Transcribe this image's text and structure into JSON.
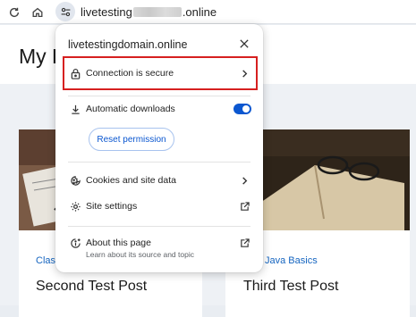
{
  "browser": {
    "address_prefix": "livetesting",
    "address_suffix": ".online"
  },
  "page": {
    "title": "My B",
    "cards": [
      {
        "category": "Clas",
        "title": "Second Test Post"
      },
      {
        "category": "Java Basics",
        "title": "Third Test Post"
      }
    ]
  },
  "popup": {
    "domain": "livetestingdomain.online",
    "connection_label": "Connection is secure",
    "auto_downloads_label": "Automatic downloads",
    "auto_downloads_enabled": true,
    "reset_button": "Reset permission",
    "cookies_label": "Cookies and site data",
    "site_settings_label": "Site settings",
    "about_label": "About this page",
    "about_sub": "Learn about its source and topic"
  },
  "colors": {
    "accent": "#0b57d0",
    "highlight_border": "#d62020",
    "link": "#1565c0"
  },
  "icons": [
    "reload-icon",
    "home-icon",
    "tune-icon",
    "close-icon",
    "lock-icon",
    "chevron-right-icon",
    "download-icon",
    "cookie-icon",
    "gear-icon",
    "open-in-new-icon",
    "info-sparkle-icon"
  ]
}
